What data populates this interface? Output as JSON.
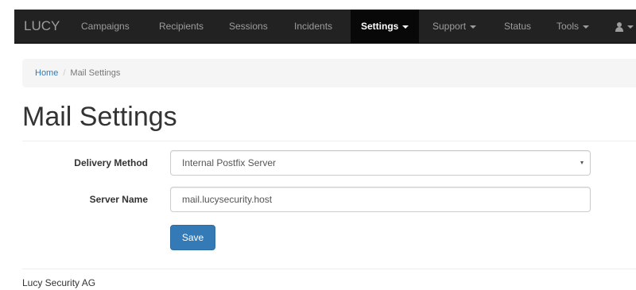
{
  "navbar": {
    "brand": "LUCY",
    "items": [
      {
        "label": "Campaigns"
      },
      {
        "label": "Recipients"
      },
      {
        "label": "Sessions"
      },
      {
        "label": "Incidents"
      },
      {
        "label": "Settings",
        "active": true,
        "dropdown": true
      },
      {
        "label": "Support",
        "dropdown": true
      },
      {
        "label": "Status"
      },
      {
        "label": "Tools",
        "dropdown": true
      }
    ],
    "user_icon": "user-icon"
  },
  "breadcrumb": {
    "home": "Home",
    "separator": "/",
    "current": "Mail Settings"
  },
  "page": {
    "title": "Mail Settings"
  },
  "form": {
    "delivery_method": {
      "label": "Delivery Method",
      "value": "Internal Postfix Server"
    },
    "server_name": {
      "label": "Server Name",
      "value": "mail.lucysecurity.host"
    },
    "save_label": "Save"
  },
  "footer": {
    "text": "Lucy Security AG"
  },
  "colors": {
    "navbar_bg": "#222222",
    "navbar_active_bg": "#080808",
    "link": "#337ab7",
    "primary_button": "#337ab7"
  }
}
